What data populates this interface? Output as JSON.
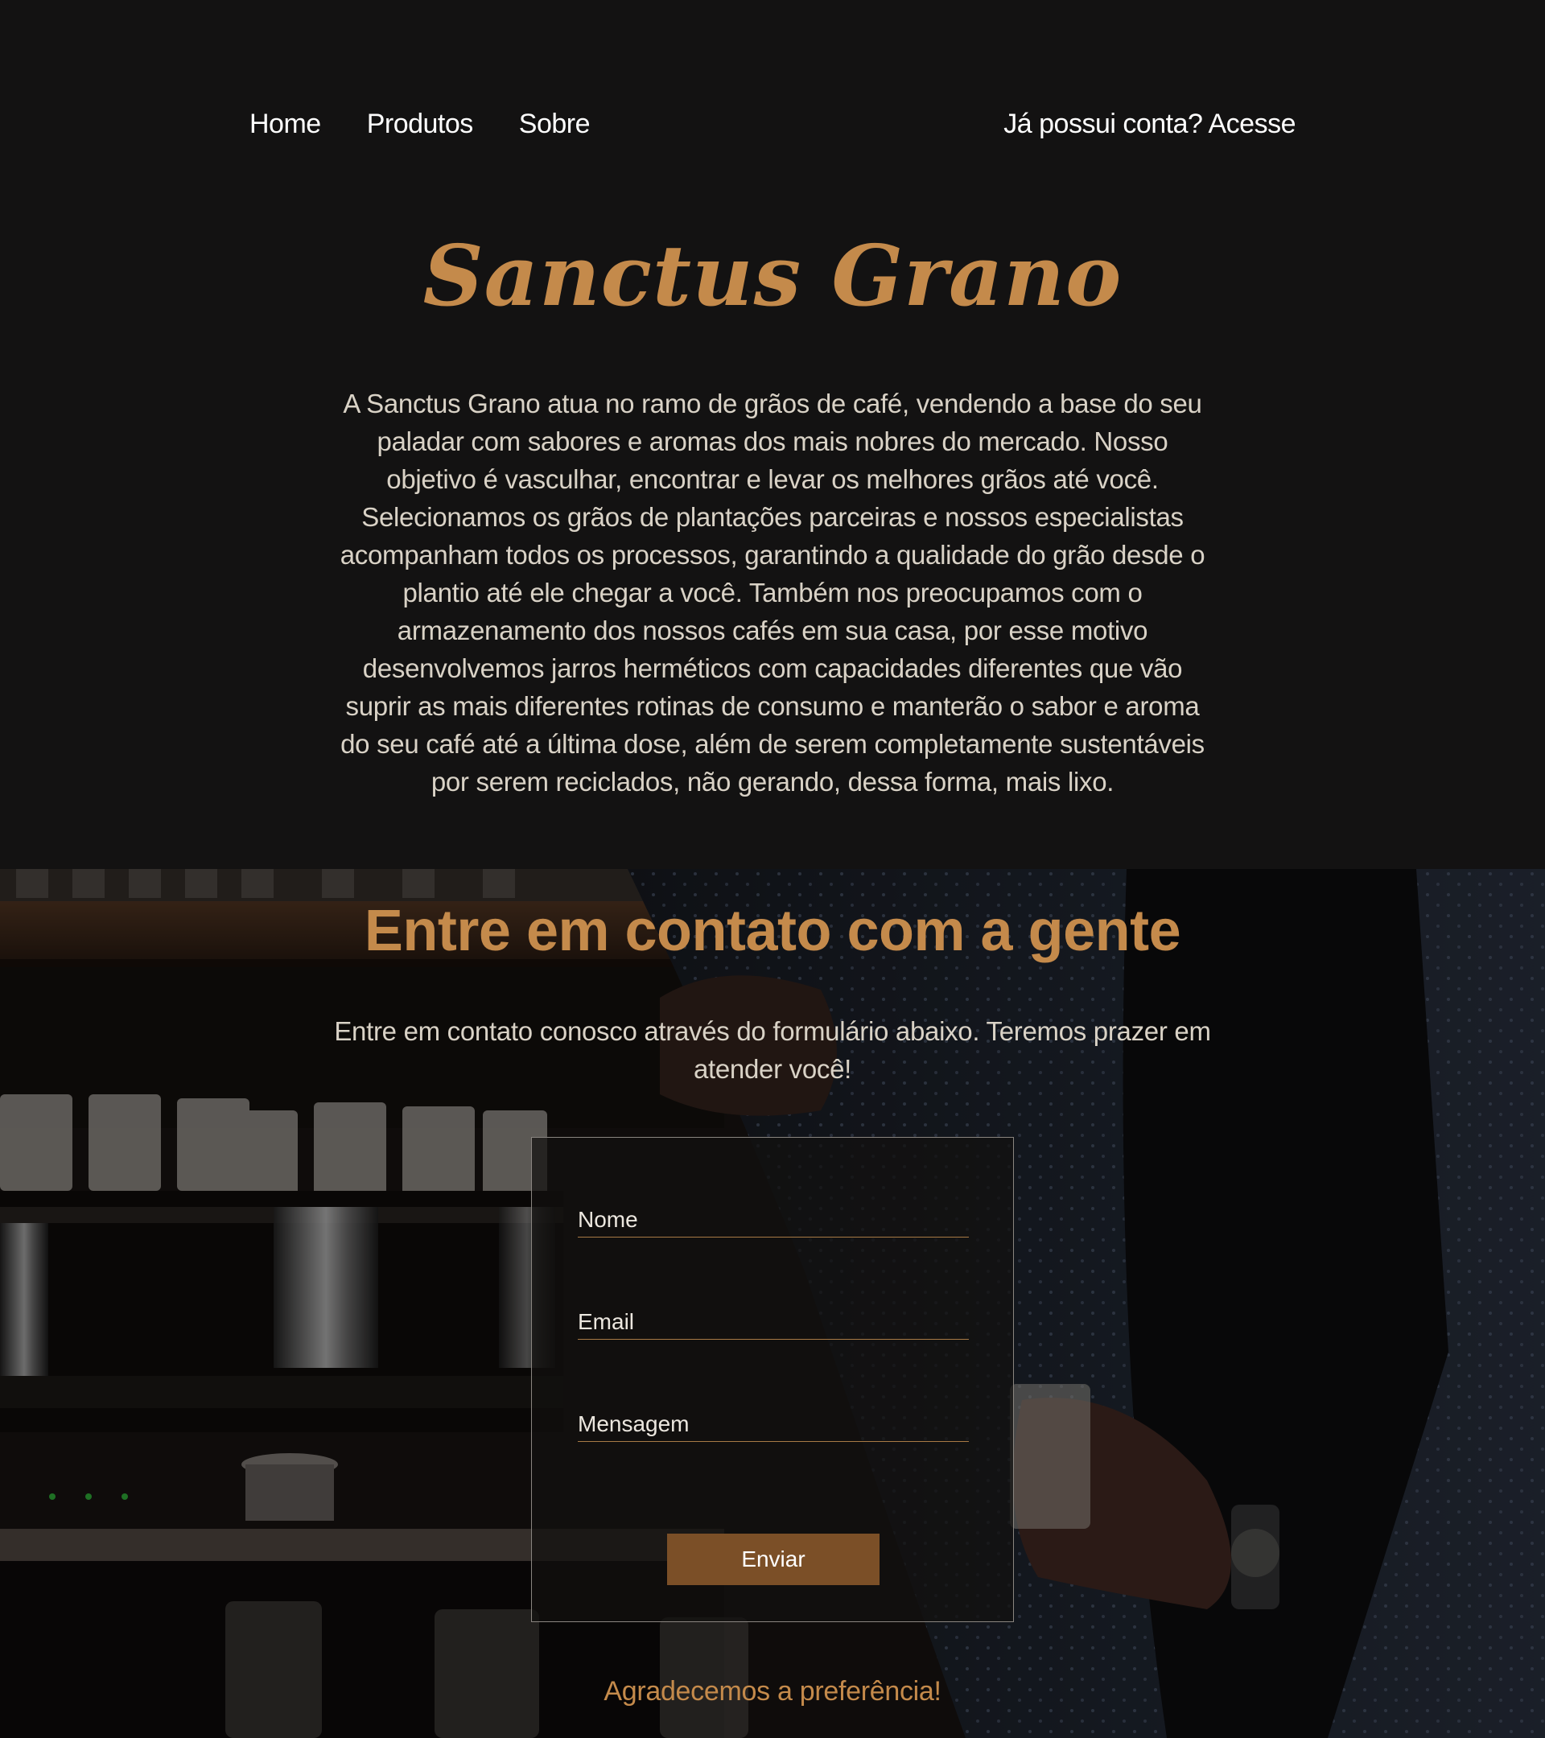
{
  "nav": {
    "links": [
      "Home",
      "Produtos",
      "Sobre"
    ],
    "login_text": "Já possui conta? Acesse"
  },
  "brand": {
    "title": "Sanctus Grano"
  },
  "about": {
    "text": "A Sanctus Grano atua no ramo de grãos de café, vendendo a base do seu paladar com sabores e aromas dos mais nobres do mercado. Nosso objetivo é vasculhar, encontrar e levar os melhores grãos até você. Selecionamos os grãos de plantações parceiras e nossos especialistas acompanham todos os processos, garantindo a qualidade do grão desde o plantio até ele chegar a você. Também nos preocupamos com o armazenamento dos nossos cafés em sua casa, por esse motivo desenvolvemos jarros herméticos com capacidades diferentes que vão suprir as mais diferentes rotinas de consumo e manterão o sabor e aroma do seu café até a última dose, além de serem completamente sustentáveis por serem reciclados, não gerando, dessa forma, mais lixo."
  },
  "contact": {
    "title": "Entre em contato com a gente",
    "subtitle": "Entre em contato conosco através do formulário abaixo. Teremos prazer em atender você!",
    "form": {
      "name_placeholder": "Nome",
      "email_placeholder": "Email",
      "message_placeholder": "Mensagem",
      "submit_label": "Enviar"
    },
    "thanks": "Agradecemos a preferência!"
  },
  "colors": {
    "background": "#131212",
    "accent": "#c48a4b",
    "button": "#7b4f27",
    "text_light": "#d9d2c6"
  }
}
